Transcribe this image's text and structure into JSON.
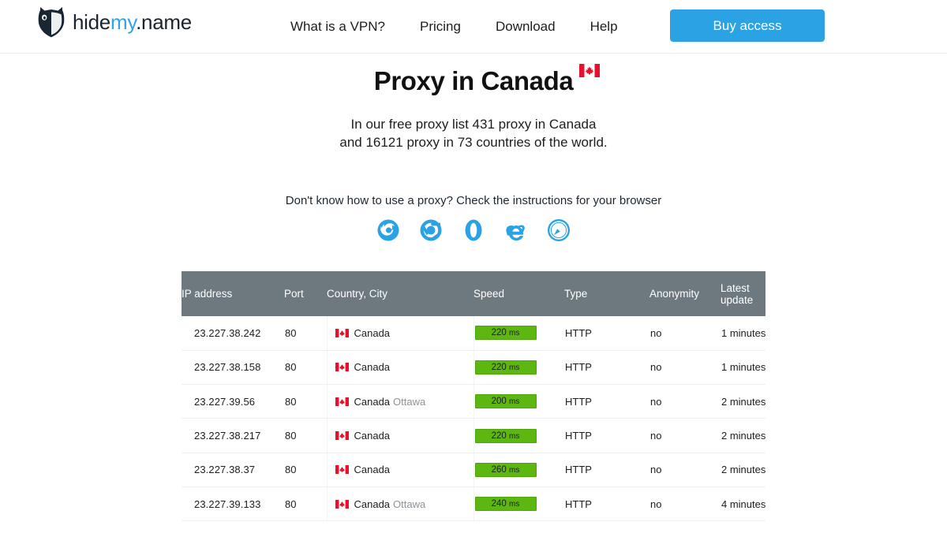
{
  "header": {
    "brand": {
      "part1": "hide",
      "part2": "my",
      "part3": ".name",
      "logo_alt": "shield-logo"
    },
    "nav": [
      {
        "label": "What is a VPN?"
      },
      {
        "label": "Pricing"
      },
      {
        "label": "Download"
      },
      {
        "label": "Help"
      }
    ],
    "buy_button": "Buy access"
  },
  "hero": {
    "title": "Proxy in Canada",
    "flag": "canada-flag",
    "lede_line1": "In our free proxy list 431 proxy in Canada",
    "lede_line2": "and 16121 proxy in 73 countries of the world.",
    "instructions": "Don't know how to use a proxy? Check the instructions for your browser",
    "browsers": [
      {
        "name": "firefox-icon"
      },
      {
        "name": "chrome-icon"
      },
      {
        "name": "opera-icon"
      },
      {
        "name": "internet-explorer-icon"
      },
      {
        "name": "safari-icon"
      }
    ]
  },
  "table": {
    "columns": [
      {
        "label": "IP address"
      },
      {
        "label": "Port"
      },
      {
        "label": "Country, City"
      },
      {
        "label": "Speed"
      },
      {
        "label": "Type"
      },
      {
        "label": "Anonymity"
      },
      {
        "label": "Latest update"
      }
    ],
    "rows": [
      {
        "ip": "23.227.38.242",
        "port": "80",
        "country": "Canada",
        "city": "",
        "speed_value": "220",
        "speed_unit": "ms",
        "type": "HTTP",
        "anonymity": "no",
        "update": "1 minutes"
      },
      {
        "ip": "23.227.38.158",
        "port": "80",
        "country": "Canada",
        "city": "",
        "speed_value": "220",
        "speed_unit": "ms",
        "type": "HTTP",
        "anonymity": "no",
        "update": "1 minutes"
      },
      {
        "ip": "23.227.39.56",
        "port": "80",
        "country": "Canada",
        "city": "Ottawa",
        "speed_value": "200",
        "speed_unit": "ms",
        "type": "HTTP",
        "anonymity": "no",
        "update": "2 minutes"
      },
      {
        "ip": "23.227.38.217",
        "port": "80",
        "country": "Canada",
        "city": "",
        "speed_value": "220",
        "speed_unit": "ms",
        "type": "HTTP",
        "anonymity": "no",
        "update": "2 minutes"
      },
      {
        "ip": "23.227.38.37",
        "port": "80",
        "country": "Canada",
        "city": "",
        "speed_value": "260",
        "speed_unit": "ms",
        "type": "HTTP",
        "anonymity": "no",
        "update": "2 minutes"
      },
      {
        "ip": "23.227.39.133",
        "port": "80",
        "country": "Canada",
        "city": "Ottawa",
        "speed_value": "240",
        "speed_unit": "ms",
        "type": "HTTP",
        "anonymity": "no",
        "update": "4 minutes"
      }
    ]
  },
  "colors": {
    "accent_blue": "#2ba2e4",
    "brand_dark": "#1a2430",
    "table_header": "#6d797f",
    "speed_green": "#5cb811",
    "city_gray": "#8b9399"
  }
}
